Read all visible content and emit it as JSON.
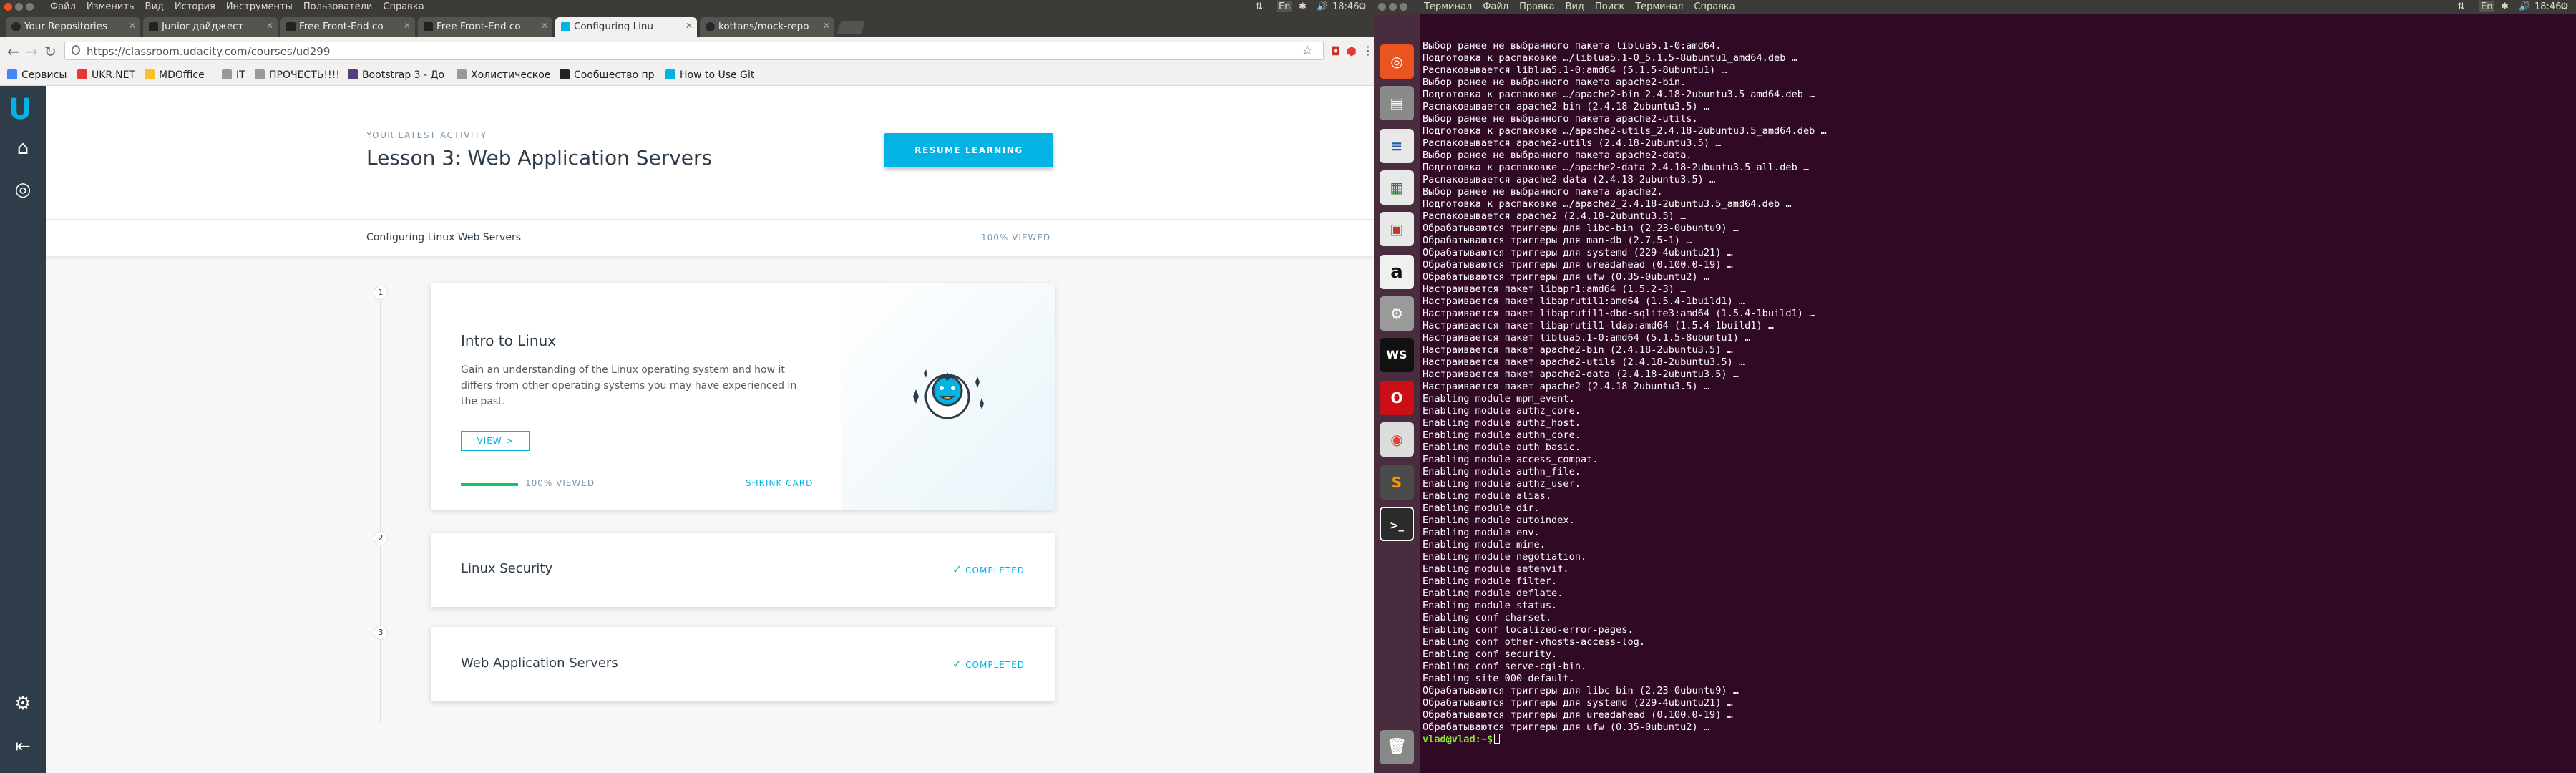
{
  "browser": {
    "menu": [
      "Файл",
      "Изменить",
      "Вид",
      "История",
      "Инструменты",
      "Пользователи",
      "Справка"
    ],
    "clock": "18:46",
    "lang": "En",
    "tabs": [
      {
        "title": "Your Repositories",
        "color": "#24292e"
      },
      {
        "title": "Junior дайджест",
        "color": "#222222"
      },
      {
        "title": "Free Front-End co",
        "color": "#222222"
      },
      {
        "title": "Free Front-End co",
        "color": "#222222"
      },
      {
        "title": "Configuring Linu",
        "color": "#02b3e4"
      },
      {
        "title": "kottans/mock-repo",
        "color": "#24292e"
      }
    ],
    "url": "https://classroom.udacity.com/courses/ud299",
    "bookmarks": [
      {
        "label": "Сервисы",
        "color": "#4285f4"
      },
      {
        "label": "UKR.NET",
        "color": "#e53935"
      },
      {
        "label": "MDOffice",
        "color": "#fbc02d"
      },
      {
        "label": "IT",
        "color": "#888888"
      },
      {
        "label": "ПРОЧЕСТЬ!!!!",
        "color": "#888888"
      },
      {
        "label": "Bootstrap 3 - До",
        "color": "#563d7c"
      },
      {
        "label": "Холистическое",
        "color": "#888888"
      },
      {
        "label": "Сообщество пр",
        "color": "#222222"
      },
      {
        "label": "How to Use Git",
        "color": "#02b3e4"
      }
    ]
  },
  "udacity": {
    "latest_label": "YOUR LATEST ACTIVITY",
    "lesson_title": "Lesson 3: Web Application Servers",
    "resume_label": "RESUME LEARNING",
    "course_title": "Configuring Linux Web Servers",
    "course_viewed": "100% VIEWED",
    "lessons": [
      {
        "num": "1",
        "title": "Intro to Linux",
        "desc": "Gain an understanding of the Linux operating system and how it differs from other operating systems you may have experienced in the past.",
        "view": "VIEW >",
        "viewed": "100% VIEWED",
        "shrink": "SHRINK CARD",
        "progress": 1.0
      },
      {
        "num": "2",
        "title": "Linux Security",
        "status": "COMPLETED"
      },
      {
        "num": "3",
        "title": "Web Application Servers",
        "status": "COMPLETED"
      }
    ]
  },
  "terminal": {
    "menu": [
      "Терминал",
      "Файл",
      "Правка",
      "Вид",
      "Поиск",
      "Терминал",
      "Справка"
    ],
    "clock": "18:46",
    "lang": "En",
    "launcher": [
      {
        "icon": "ubuntu-icon",
        "bg": "#e95420",
        "glyph": ""
      },
      {
        "icon": "files-icon",
        "bg": "#8a8a8a",
        "glyph": ""
      },
      {
        "icon": "writer-icon",
        "bg": "#e8e8e8",
        "glyph": ""
      },
      {
        "icon": "calc-icon",
        "bg": "#e8e8e8",
        "glyph": ""
      },
      {
        "icon": "impress-icon",
        "bg": "#e8e8e8",
        "glyph": ""
      },
      {
        "icon": "amazon-icon",
        "bg": "#f0f0f0",
        "glyph": "a"
      },
      {
        "icon": "settings-icon",
        "bg": "#9a9a9a",
        "glyph": "⚙"
      },
      {
        "icon": "webstorm-icon",
        "bg": "#111111",
        "glyph": "WS"
      },
      {
        "icon": "opera-icon",
        "bg": "#cc0f16",
        "glyph": "O"
      },
      {
        "icon": "chrome-icon",
        "bg": "#dddddd",
        "glyph": ""
      },
      {
        "icon": "sublime-icon",
        "bg": "#4b4b4b",
        "glyph": "S"
      },
      {
        "icon": "terminal-icon",
        "bg": "#2b2b2b",
        "glyph": ">_"
      }
    ],
    "lines": [
      "Выбор ранее не выбранного пакета liblua5.1-0:amd64.",
      "Подготовка к распаковке …/liblua5.1-0_5.1.5-8ubuntu1_amd64.deb …",
      "Распаковывается liblua5.1-0:amd64 (5.1.5-8ubuntu1) …",
      "Выбор ранее не выбранного пакета apache2-bin.",
      "Подготовка к распаковке …/apache2-bin_2.4.18-2ubuntu3.5_amd64.deb …",
      "Распаковывается apache2-bin (2.4.18-2ubuntu3.5) …",
      "Выбор ранее не выбранного пакета apache2-utils.",
      "Подготовка к распаковке …/apache2-utils_2.4.18-2ubuntu3.5_amd64.deb …",
      "Распаковывается apache2-utils (2.4.18-2ubuntu3.5) …",
      "Выбор ранее не выбранного пакета apache2-data.",
      "Подготовка к распаковке …/apache2-data_2.4.18-2ubuntu3.5_all.deb …",
      "Распаковывается apache2-data (2.4.18-2ubuntu3.5) …",
      "Выбор ранее не выбранного пакета apache2.",
      "Подготовка к распаковке …/apache2_2.4.18-2ubuntu3.5_amd64.deb …",
      "Распаковывается apache2 (2.4.18-2ubuntu3.5) …",
      "Обрабатываются триггеры для libc-bin (2.23-0ubuntu9) …",
      "Обрабатываются триггеры для man-db (2.7.5-1) …",
      "Обрабатываются триггеры для systemd (229-4ubuntu21) …",
      "Обрабатываются триггеры для ureadahead (0.100.0-19) …",
      "Обрабатываются триггеры для ufw (0.35-0ubuntu2) …",
      "Настраивается пакет libapr1:amd64 (1.5.2-3) …",
      "Настраивается пакет libaprutil1:amd64 (1.5.4-1build1) …",
      "Настраивается пакет libaprutil1-dbd-sqlite3:amd64 (1.5.4-1build1) …",
      "Настраивается пакет libaprutil1-ldap:amd64 (1.5.4-1build1) …",
      "Настраивается пакет liblua5.1-0:amd64 (5.1.5-8ubuntu1) …",
      "Настраивается пакет apache2-bin (2.4.18-2ubuntu3.5) …",
      "Настраивается пакет apache2-utils (2.4.18-2ubuntu3.5) …",
      "Настраивается пакет apache2-data (2.4.18-2ubuntu3.5) …",
      "Настраивается пакет apache2 (2.4.18-2ubuntu3.5) …",
      "Enabling module mpm_event.",
      "Enabling module authz_core.",
      "Enabling module authz_host.",
      "Enabling module authn_core.",
      "Enabling module auth_basic.",
      "Enabling module access_compat.",
      "Enabling module authn_file.",
      "Enabling module authz_user.",
      "Enabling module alias.",
      "Enabling module dir.",
      "Enabling module autoindex.",
      "Enabling module env.",
      "Enabling module mime.",
      "Enabling module negotiation.",
      "Enabling module setenvif.",
      "Enabling module filter.",
      "Enabling module deflate.",
      "Enabling module status.",
      "Enabling conf charset.",
      "Enabling conf localized-error-pages.",
      "Enabling conf other-vhosts-access-log.",
      "Enabling conf security.",
      "Enabling conf serve-cgi-bin.",
      "Enabling site 000-default.",
      "Обрабатываются триггеры для libc-bin (2.23-0ubuntu9) …",
      "Обрабатываются триггеры для systemd (229-4ubuntu21) …",
      "Обрабатываются триггеры для ureadahead (0.100.0-19) …",
      "Обрабатываются триггеры для ufw (0.35-0ubuntu2) …"
    ],
    "prompt": "vlad@vlad:~$"
  }
}
